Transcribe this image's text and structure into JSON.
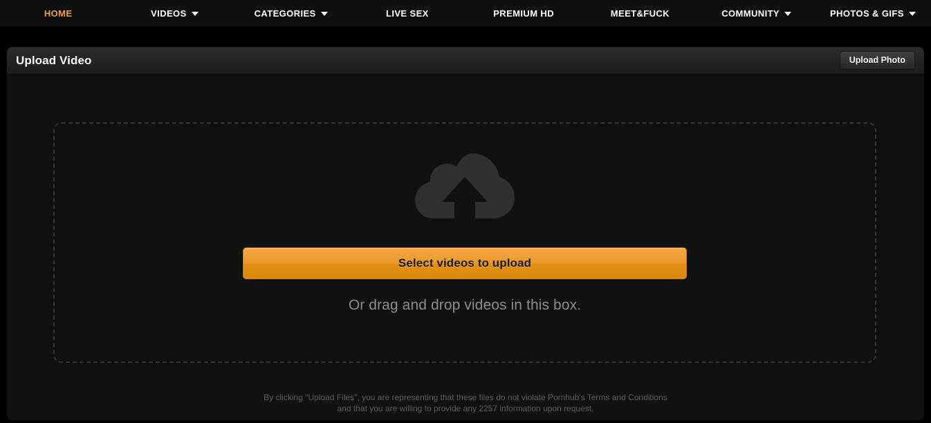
{
  "nav": {
    "items": [
      {
        "label": "HOME",
        "has_caret": false,
        "name": "nav-item-home"
      },
      {
        "label": "VIDEOS",
        "has_caret": true,
        "name": "nav-item-videos"
      },
      {
        "label": "CATEGORIES",
        "has_caret": true,
        "name": "nav-item-categories"
      },
      {
        "label": "LIVE SEX",
        "has_caret": false,
        "name": "nav-item-live-sex"
      },
      {
        "label": "PREMIUM HD",
        "has_caret": false,
        "name": "nav-item-premium-hd"
      },
      {
        "label": "MEET&FUCK",
        "has_caret": false,
        "name": "nav-item-meet-and-fuck"
      },
      {
        "label": "COMMUNITY",
        "has_caret": true,
        "name": "nav-item-community"
      },
      {
        "label": "PHOTOS & GIFS",
        "has_caret": true,
        "name": "nav-item-photos-and-gifs"
      }
    ]
  },
  "panel": {
    "title": "Upload Video",
    "upload_photo_label": "Upload Photo"
  },
  "dropzone": {
    "icon": "cloud-upload-icon",
    "select_button_label": "Select videos to upload",
    "drag_hint": "Or drag and drop videos in this box."
  },
  "disclaimer": {
    "line1": "By clicking \"Upload Files\", you are representing that these files do not violate Pornhub's Terms and Conditions",
    "line2": "and that you are willing to provide any 2257 information upon request."
  },
  "colors": {
    "page_background": "#000000",
    "nav_background": "#0f0f0f",
    "panel_background": "#111111",
    "panel_header_top": "#2c2c2c",
    "panel_header_bottom": "#1c1c1c",
    "accent_orange_light": "#f3a945",
    "accent_orange_dark": "#dd8a0d",
    "dashed_border": "#343434",
    "cloud_icon": "#303030",
    "hint_text": "#8c8c8c",
    "disclaimer_text": "#5a5a5a"
  }
}
